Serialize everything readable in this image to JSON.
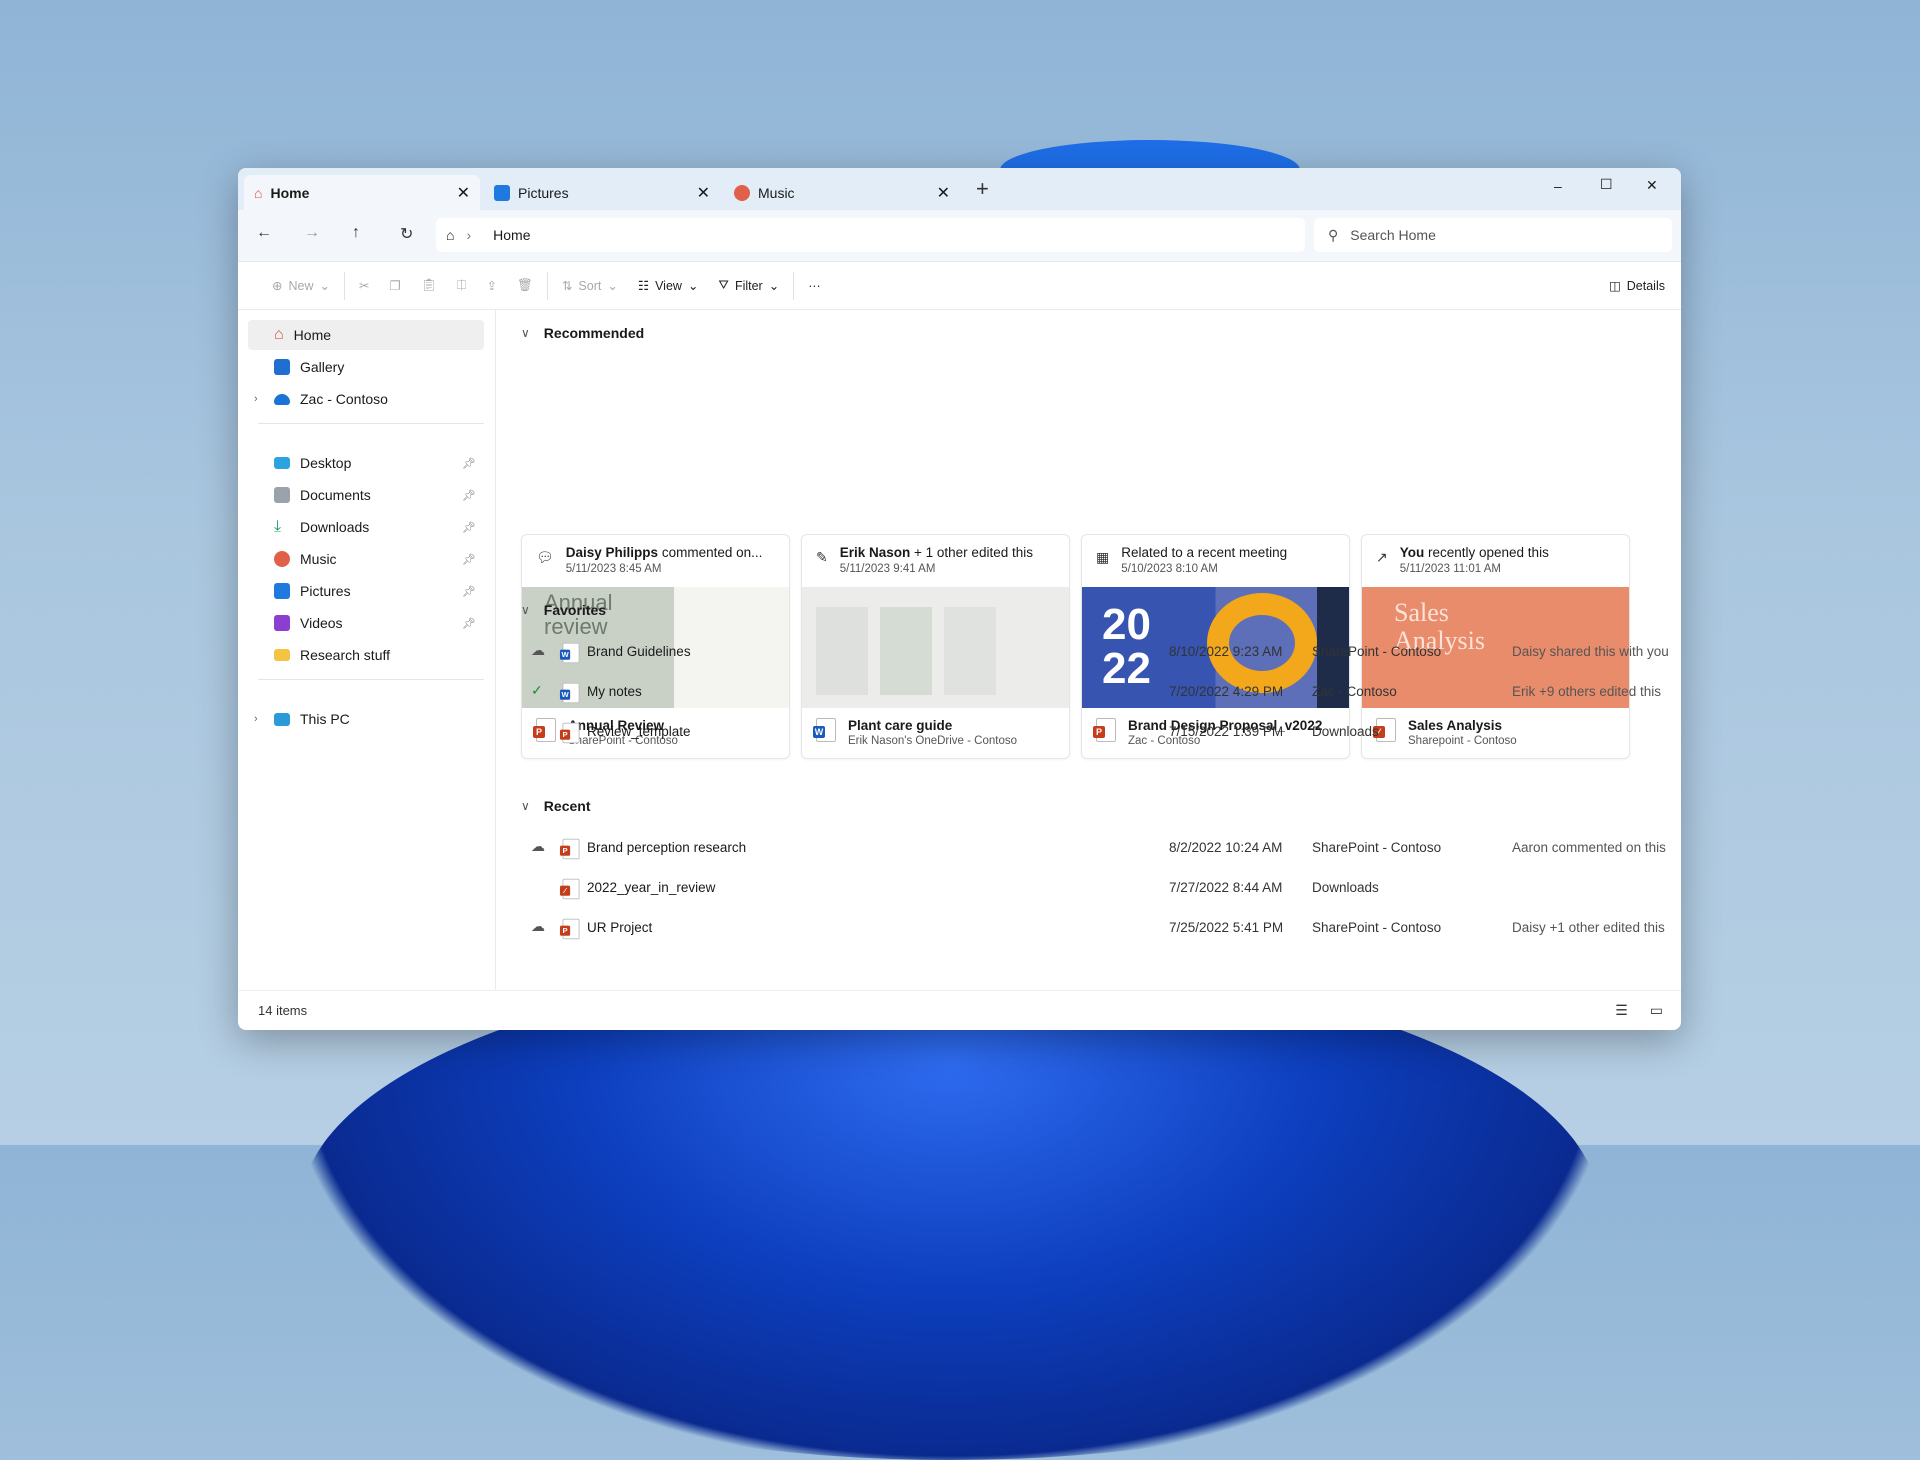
{
  "tabs": [
    {
      "label": "Home",
      "icon": "home-icon",
      "active": true
    },
    {
      "label": "Pictures",
      "icon": "pictures-icon"
    },
    {
      "label": "Music",
      "icon": "music-icon"
    }
  ],
  "new_tab": "+",
  "window_controls": {
    "minimize": "–",
    "maximize": "☐",
    "close": "✕"
  },
  "address": {
    "crumb": "Home",
    "separator": "›"
  },
  "search": {
    "placeholder": "Search Home"
  },
  "toolbar": {
    "new": "New",
    "sort": "Sort",
    "view": "View",
    "filter": "Filter",
    "more": "···",
    "details": "Details"
  },
  "sidebar": {
    "items": [
      {
        "label": "Home",
        "icon": "home-icon",
        "selected": true
      },
      {
        "label": "Gallery",
        "icon": "gallery-icon"
      },
      {
        "label": "Zac - Contoso",
        "icon": "onedrive-cloud-icon",
        "expandable": true
      },
      {
        "label": "Desktop",
        "icon": "desktop-icon",
        "pinned": true
      },
      {
        "label": "Documents",
        "icon": "documents-icon",
        "pinned": true
      },
      {
        "label": "Downloads",
        "icon": "downloads-icon",
        "pinned": true
      },
      {
        "label": "Music",
        "icon": "music-icon",
        "pinned": true
      },
      {
        "label": "Pictures",
        "icon": "pictures-icon",
        "pinned": true
      },
      {
        "label": "Videos",
        "icon": "videos-icon",
        "pinned": true
      },
      {
        "label": "Research stuff",
        "icon": "folder-icon"
      },
      {
        "label": "This PC",
        "icon": "this-pc-icon",
        "expandable": true
      }
    ]
  },
  "recommended": {
    "title": "Recommended",
    "cards": [
      {
        "actor": "Daisy Philipps",
        "activity": " commented on...",
        "date": "5/11/2023 8:45 AM",
        "name": "Annual Review",
        "location": "SharePoint - Contoso",
        "thumb_text": "Annual review",
        "type": "powerpoint"
      },
      {
        "actor": "Erik Nason",
        "activity": " + 1 other edited this",
        "date": "5/11/2023 9:41 AM",
        "name": "Plant care guide",
        "location": "Erik Nason's OneDrive - Contoso",
        "type": "word"
      },
      {
        "actor": "",
        "activity": "Related to a recent meeting",
        "date": "5/10/2023 8:10 AM",
        "name": "Brand Design Proposal_v2022",
        "location": "Zac - Contoso",
        "thumb_text": "20 22",
        "type": "powerpoint"
      },
      {
        "actor": "You",
        "activity": " recently opened this",
        "date": "5/11/2023 11:01 AM",
        "name": "Sales Analysis",
        "location": "Sharepoint - Contoso",
        "thumb_text": "Sales Analysis",
        "type": "pdf"
      }
    ]
  },
  "favorites": {
    "title": "Favorites",
    "rows": [
      {
        "name": "Brand Guidelines",
        "date": "8/10/2022 9:23 AM",
        "location": "SharePoint - Contoso",
        "activity": "Daisy shared this with you",
        "status": "cloud",
        "type": "word"
      },
      {
        "name": "My notes",
        "date": "7/20/2022 4:29 PM",
        "location": "Zac - Contoso",
        "activity": "Erik +9 others edited this",
        "status": "synced",
        "type": "word"
      },
      {
        "name": "Review_template",
        "date": "7/15/2022 1:39 PM",
        "location": "Downloads",
        "activity": "",
        "status": "",
        "type": "powerpoint"
      }
    ]
  },
  "recent": {
    "title": "Recent",
    "rows": [
      {
        "name": "Brand perception research",
        "date": "8/2/2022 10:24 AM",
        "location": "SharePoint - Contoso",
        "activity": "Aaron commented on this",
        "status": "cloud",
        "type": "powerpoint"
      },
      {
        "name": "2022_year_in_review",
        "date": "7/27/2022 8:44 AM",
        "location": "Downloads",
        "activity": "",
        "status": "",
        "type": "pdf"
      },
      {
        "name": "UR Project",
        "date": "7/25/2022 5:41 PM",
        "location": "SharePoint - Contoso",
        "activity": "Daisy +1 other edited this",
        "status": "cloud",
        "type": "powerpoint"
      }
    ]
  },
  "status": {
    "items": "14 items"
  },
  "colors": {
    "accent": "#0067c0",
    "word": "#185abd",
    "powerpoint": "#c43e1c",
    "tabbar": "#e3edf7"
  }
}
